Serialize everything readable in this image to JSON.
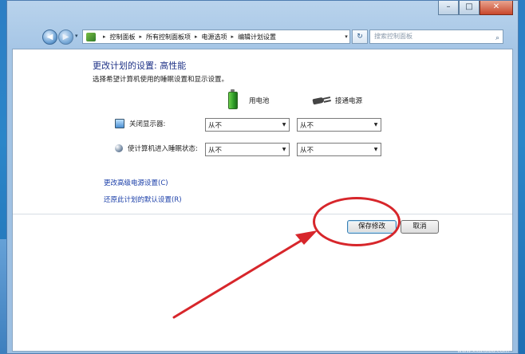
{
  "window": {
    "caption_buttons": [
      "–",
      "□",
      "✕"
    ]
  },
  "nav": {
    "back_icon": "◀",
    "forward_icon": "▶",
    "recent_icon": "▾",
    "breadcrumb": [
      "控制面板",
      "所有控制面板项",
      "电源选项",
      "编辑计划设置"
    ],
    "breadcrumb_sep": "▸",
    "dropdown_icon": "▾",
    "refresh_icon": "↻",
    "search_placeholder": "搜索控制面板",
    "search_icon": "⌕"
  },
  "content": {
    "title": "更改计划的设置: 高性能",
    "subtitle": "选择希望计算机使用的睡眠设置和显示设置。",
    "columns": {
      "battery": "用电池",
      "plugged": "接通电源"
    },
    "rows": [
      {
        "label": "关闭显示器:",
        "battery_value": "从不",
        "plugged_value": "从不"
      },
      {
        "label": "使计算机进入睡眠状态:",
        "battery_value": "从不",
        "plugged_value": "从不"
      }
    ],
    "links": {
      "advanced": "更改高级电源设置(C)",
      "restore": "还原此计划的默认设置(R)"
    },
    "buttons": {
      "save": "保存修改",
      "cancel": "取消"
    },
    "select_arrow": "▼"
  },
  "watermark": {
    "text": "下载吧",
    "url": "www.xiazaiba.com"
  },
  "colors": {
    "annotation_red": "#d7262b",
    "title_blue": "#1e3287",
    "link_blue": "#1a3ea8"
  }
}
